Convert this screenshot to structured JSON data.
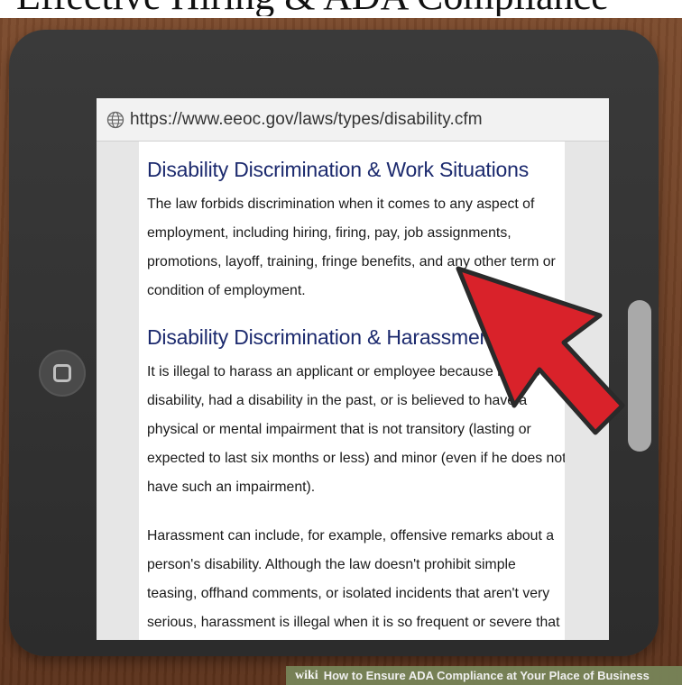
{
  "header": {
    "title": "Effective Hiring & ADA Compliance"
  },
  "browser": {
    "url": "https://www.eeoc.gov/laws/types/disability.cfm"
  },
  "article": {
    "sections": [
      {
        "heading": "Disability Discrimination & Work Situations",
        "paragraphs": [
          "The law forbids discrimination when it comes to any aspect of employment, including hiring, firing, pay, job assignments, promotions, layoff, training, fringe benefits, and any other term or condition of employment."
        ]
      },
      {
        "heading": "Disability Discrimination & Harassment",
        "paragraphs": [
          "It is illegal to harass an applicant or employee because he has a disability, had a disability in the past, or is believed to have a physical or mental impairment that is not transitory (lasting or expected to last six months or less) and minor (even if he does not have such an impairment).",
          "Harassment can include, for example, offensive remarks about a person's disability. Although the law doesn't prohibit simple teasing, offhand comments, or isolated incidents that aren't very serious, harassment is illegal when it is so frequent or severe that it creates a hostile or offensive work environment."
        ]
      }
    ]
  },
  "footer": {
    "brand": "wiki",
    "caption": "How to Ensure ADA Compliance at Your Place of Business"
  },
  "icons": {
    "globe": "globe-icon",
    "home": "home-button-icon",
    "cursor": "arrow-cursor-icon"
  },
  "colors": {
    "heading": "#1c2a6e",
    "cursor": "#d9222a",
    "tablet": "#2f2f2f"
  }
}
